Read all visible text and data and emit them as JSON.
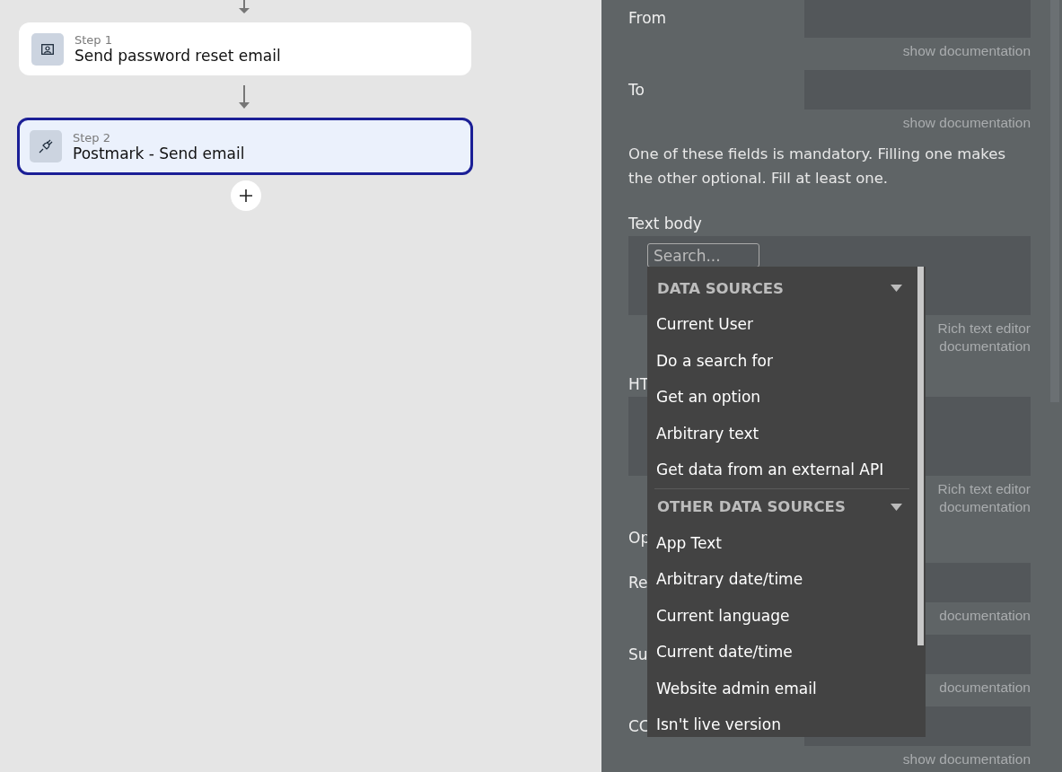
{
  "flow": {
    "steps": [
      {
        "label": "Step 1",
        "title": "Send password reset email",
        "kind": "user",
        "selected": false
      },
      {
        "label": "Step 2",
        "title": "Postmark - Send email",
        "kind": "plugin",
        "selected": true
      }
    ]
  },
  "panel": {
    "rows": [
      {
        "kind": "field",
        "label": "From",
        "doc": [
          "show documentation"
        ]
      },
      {
        "kind": "field",
        "label": "To",
        "doc": [
          "show documentation"
        ]
      },
      {
        "kind": "note",
        "text": "One of these fields is mandatory. Filling one makes the other optional. Fill at least one."
      },
      {
        "kind": "richtext",
        "label": "Text body",
        "doc": [
          "Rich text editor",
          "documentation"
        ]
      },
      {
        "kind": "richtext",
        "label": "HT",
        "doc": [
          "Rich text editor",
          "documentation"
        ]
      },
      {
        "kind": "heading",
        "label": "Op"
      },
      {
        "kind": "field",
        "label": "Re",
        "doc": [
          "documentation"
        ]
      },
      {
        "kind": "field",
        "label": "Su",
        "doc": [
          "documentation"
        ]
      },
      {
        "kind": "field",
        "label": "CC",
        "doc": [
          "show documentation"
        ]
      }
    ]
  },
  "dropdown": {
    "search": {
      "placeholder": "Search..."
    },
    "groups": [
      {
        "title": "DATA SOURCES",
        "expanded": true,
        "items": [
          "Current User",
          "Do a search for",
          "Get an option",
          "Arbitrary text",
          "Get data from an external API"
        ]
      },
      {
        "title": "OTHER DATA SOURCES",
        "expanded": true,
        "items": [
          "App Text",
          "Arbitrary date/time",
          "Current language",
          "Current date/time",
          "Website admin email",
          "Isn't live version"
        ]
      }
    ]
  }
}
